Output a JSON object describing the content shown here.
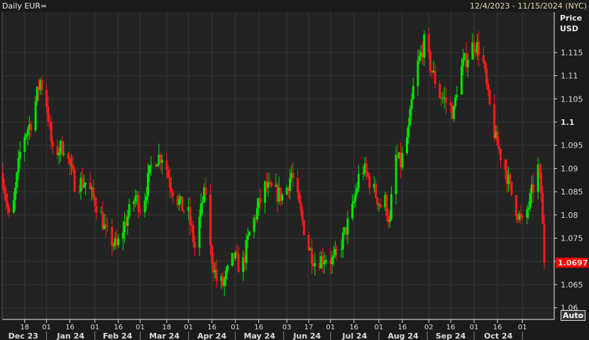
{
  "header": {
    "title": "Daily EUR=",
    "date_range": "12/4/2023 - 11/15/2024 (NYC)"
  },
  "axis": {
    "price_label": "Price",
    "currency": "USD",
    "auto_button": "Auto"
  },
  "colors": {
    "up": "#00e400",
    "down": "#ff1a1a",
    "last_price_bg": "#ff0000"
  },
  "chart_data": {
    "type": "candlestick",
    "title": "Daily EUR=",
    "ylabel": "Price USD",
    "ylim": [
      1.058,
      1.123
    ],
    "y_ticks": [
      1.06,
      1.065,
      1.07,
      1.075,
      1.08,
      1.085,
      1.09,
      1.095,
      1.1,
      1.105,
      1.11,
      1.115
    ],
    "y_tick_labels": [
      "1.06",
      "1.065",
      "1.07",
      "1.075",
      "1.08",
      "1.085",
      "1.09",
      "1.095",
      "1.1",
      "1.105",
      "1.11",
      "1.115"
    ],
    "x_start": "2023-12-04",
    "x_end": "2024-11-15",
    "x_day_ticks": [
      {
        "day": 14,
        "label": "18"
      },
      {
        "day": 28,
        "label": "01"
      },
      {
        "day": 43,
        "label": "16"
      },
      {
        "day": 59,
        "label": "01"
      },
      {
        "day": 74,
        "label": "16"
      },
      {
        "day": 88,
        "label": "01"
      },
      {
        "day": 105,
        "label": "18"
      },
      {
        "day": 119,
        "label": "01"
      },
      {
        "day": 134,
        "label": "16"
      },
      {
        "day": 149,
        "label": "01"
      },
      {
        "day": 164,
        "label": "16"
      },
      {
        "day": 182,
        "label": "03"
      },
      {
        "day": 196,
        "label": "17"
      },
      {
        "day": 210,
        "label": "01"
      },
      {
        "day": 225,
        "label": "16"
      },
      {
        "day": 241,
        "label": "01"
      },
      {
        "day": 256,
        "label": "16"
      },
      {
        "day": 273,
        "label": "02"
      },
      {
        "day": 287,
        "label": "16"
      },
      {
        "day": 302,
        "label": "01"
      },
      {
        "day": 317,
        "label": "16"
      },
      {
        "day": 333,
        "label": "01"
      }
    ],
    "months": [
      {
        "label": "Dec 23",
        "from": -3,
        "to": 28
      },
      {
        "label": "Jan 24",
        "from": 28,
        "to": 59
      },
      {
        "label": "Feb 24",
        "from": 59,
        "to": 88
      },
      {
        "label": "Mar 24",
        "from": 88,
        "to": 119
      },
      {
        "label": "Apr 24",
        "from": 119,
        "to": 149
      },
      {
        "label": "May 24",
        "from": 149,
        "to": 180
      },
      {
        "label": "Jun 24",
        "from": 180,
        "to": 210
      },
      {
        "label": "Jul 24",
        "from": 210,
        "to": 241
      },
      {
        "label": "Aug 24",
        "from": 241,
        "to": 272
      },
      {
        "label": "Sep 24",
        "from": 272,
        "to": 302
      },
      {
        "label": "Oct 24",
        "from": 302,
        "to": 333
      }
    ],
    "close_path_days_price": [
      [
        0,
        1.088
      ],
      [
        5,
        1.077
      ],
      [
        12,
        1.096
      ],
      [
        18,
        1.1
      ],
      [
        24,
        1.109
      ],
      [
        28,
        1.104
      ],
      [
        32,
        1.093
      ],
      [
        39,
        1.095
      ],
      [
        46,
        1.087
      ],
      [
        53,
        1.087
      ],
      [
        62,
        1.081
      ],
      [
        66,
        1.076
      ],
      [
        73,
        1.073
      ],
      [
        78,
        1.078
      ],
      [
        85,
        1.084
      ],
      [
        89,
        1.081
      ],
      [
        96,
        1.092
      ],
      [
        103,
        1.093
      ],
      [
        107,
        1.087
      ],
      [
        114,
        1.082
      ],
      [
        119,
        1.08
      ],
      [
        123,
        1.073
      ],
      [
        128,
        1.083
      ],
      [
        130,
        1.085
      ],
      [
        132,
        1.074
      ],
      [
        137,
        1.066
      ],
      [
        141,
        1.065
      ],
      [
        148,
        1.071
      ],
      [
        153,
        1.068
      ],
      [
        158,
        1.076
      ],
      [
        162,
        1.08
      ],
      [
        168,
        1.086
      ],
      [
        173,
        1.085
      ],
      [
        180,
        1.084
      ],
      [
        185,
        1.089
      ],
      [
        191,
        1.08
      ],
      [
        196,
        1.073
      ],
      [
        200,
        1.07
      ],
      [
        207,
        1.071
      ],
      [
        212,
        1.07
      ],
      [
        217,
        1.074
      ],
      [
        224,
        1.081
      ],
      [
        228,
        1.088
      ],
      [
        231,
        1.09
      ],
      [
        237,
        1.086
      ],
      [
        242,
        1.082
      ],
      [
        245,
        1.083
      ],
      [
        248,
        1.078
      ],
      [
        251,
        1.093
      ],
      [
        255,
        1.091
      ],
      [
        260,
        1.098
      ],
      [
        264,
        1.11
      ],
      [
        270,
        1.117
      ],
      [
        275,
        1.111
      ],
      [
        280,
        1.106
      ],
      [
        285,
        1.104
      ],
      [
        289,
        1.102
      ],
      [
        292,
        1.11
      ],
      [
        296,
        1.113
      ],
      [
        302,
        1.117
      ],
      [
        307,
        1.115
      ],
      [
        311,
        1.105
      ],
      [
        316,
        1.096
      ],
      [
        322,
        1.09
      ],
      [
        327,
        1.083
      ],
      [
        333,
        1.078
      ],
      [
        337,
        1.082
      ],
      [
        343,
        1.09
      ],
      [
        345,
        1.085
      ],
      [
        347,
        1.0697
      ]
    ],
    "last_price": "1.0697"
  }
}
